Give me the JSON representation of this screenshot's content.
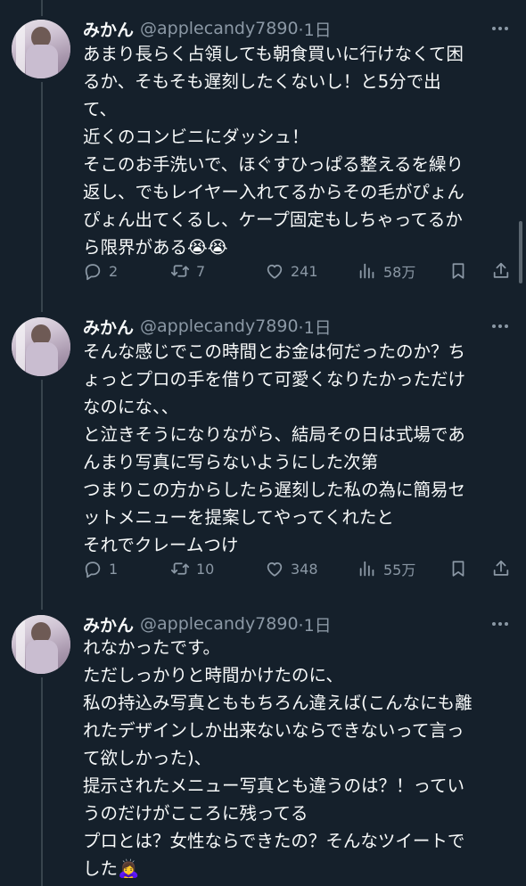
{
  "tweets": [
    {
      "display_name": "みかん",
      "handle": "@applecandy7890",
      "time": "·1日",
      "lines": [
        "あまり長らく占領しても朝食買いに行けなくて困",
        "るか、そもそも遅刻したくないし！と5分で出",
        "て、",
        "近くのコンビニにダッシュ！",
        "そこのお手洗いで、ほぐすひっぱる整えるを繰り",
        "返し、でもレイヤー入れてるからその毛がぴょん",
        "ぴょん出てくるし、ケープ固定もしちゃってるか",
        "ら限界がある😭😭"
      ],
      "replies": "2",
      "retweets": "7",
      "likes": "241",
      "views": "58万"
    },
    {
      "display_name": "みかん",
      "handle": "@applecandy7890",
      "time": "·1日",
      "lines": [
        "そんな感じでこの時間とお金は何だったのか？ち",
        "ょっとプロの手を借りて可愛くなりたかっただけ",
        "なのにな、、",
        "と泣きそうになりながら、結局その日は式場であ",
        "んまり写真に写らないようにした次第",
        "つまりこの方からしたら遅刻した私の為に簡易セ",
        "ットメニューを提案してやってくれたと",
        "それでクレームつけ"
      ],
      "replies": "1",
      "retweets": "10",
      "likes": "348",
      "views": "55万"
    },
    {
      "display_name": "みかん",
      "handle": "@applecandy7890",
      "time": "·1日",
      "lines": [
        "れなかったです。",
        "ただしっかりと時間かけたのに、",
        "私の持込み写真とももちろん違えば(こんなにも離",
        "れたデザインしか出来ないならできないって言っ",
        "て欲しかった)、",
        "提示されたメニュー写真とも違うのは？！ってい",
        "うのだけがこころに残ってる",
        "プロとは？女性ならできたの？そんなツイートで",
        "した🙇‍♀️"
      ]
    }
  ],
  "icons": {
    "reply": "reply-icon",
    "retweet": "retweet-icon",
    "like": "like-icon",
    "views": "views-icon",
    "bookmark": "bookmark-icon",
    "share": "share-icon",
    "more": "more-icon"
  },
  "colors": {
    "background": "#15202b",
    "text": "#f7f9f9",
    "secondary": "#8b98a5",
    "thread_line": "#38444d"
  }
}
